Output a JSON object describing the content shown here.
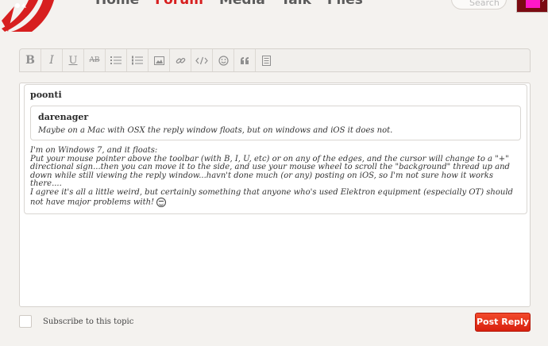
{
  "nav": {
    "items": [
      {
        "label": "Home",
        "active": false
      },
      {
        "label": "Forum",
        "active": true
      },
      {
        "label": "Media",
        "active": false
      },
      {
        "label": "Talk",
        "active": false
      },
      {
        "label": "Files",
        "active": false
      }
    ]
  },
  "search": {
    "placeholder": "Search"
  },
  "toolbar": {
    "buttons": [
      {
        "name": "bold-button",
        "glyph": "B"
      },
      {
        "name": "italic-button",
        "glyph": "I"
      },
      {
        "name": "underline-button",
        "glyph": "U"
      },
      {
        "name": "strikethrough-button",
        "glyph": "AB"
      },
      {
        "name": "bullet-list-button",
        "icon": "bullet-list-icon"
      },
      {
        "name": "numbered-list-button",
        "icon": "numbered-list-icon"
      },
      {
        "name": "image-button",
        "icon": "image-icon"
      },
      {
        "name": "link-button",
        "icon": "link-icon"
      },
      {
        "name": "code-button",
        "icon": "code-icon"
      },
      {
        "name": "emoji-button",
        "icon": "smiley-icon"
      },
      {
        "name": "quote-button",
        "icon": "quote-icon"
      },
      {
        "name": "document-button",
        "icon": "document-icon"
      }
    ]
  },
  "post": {
    "author": "poonti",
    "quote": {
      "author": "darenager",
      "text": "Maybe on a Mac with OSX the reply window floats, but on windows and iOS it does not."
    },
    "lines": [
      "I'm on Windows 7, and it floats:",
      "Put your mouse pointer above the toolbar (with B, I, U, etc) or on any of the edges, and the cursor will change to a \"+\" directional sign...then you can move it to the side, and use your mouse wheel to scroll the \"background\" thread up and down while still viewing the reply window...havn't done much (or any) posting on iOS, so I'm not sure how it works there....",
      "I agree it's all a little weird, but certainly something that anyone who's used Elektron equipment (especially OT) should not have major problems with!"
    ]
  },
  "footer": {
    "subscribe_label": "Subscribe to this topic",
    "post_button": "Post Reply"
  },
  "colors": {
    "accent": "#d71f1f",
    "button": "#e5321b",
    "background": "#f4f2ef"
  }
}
